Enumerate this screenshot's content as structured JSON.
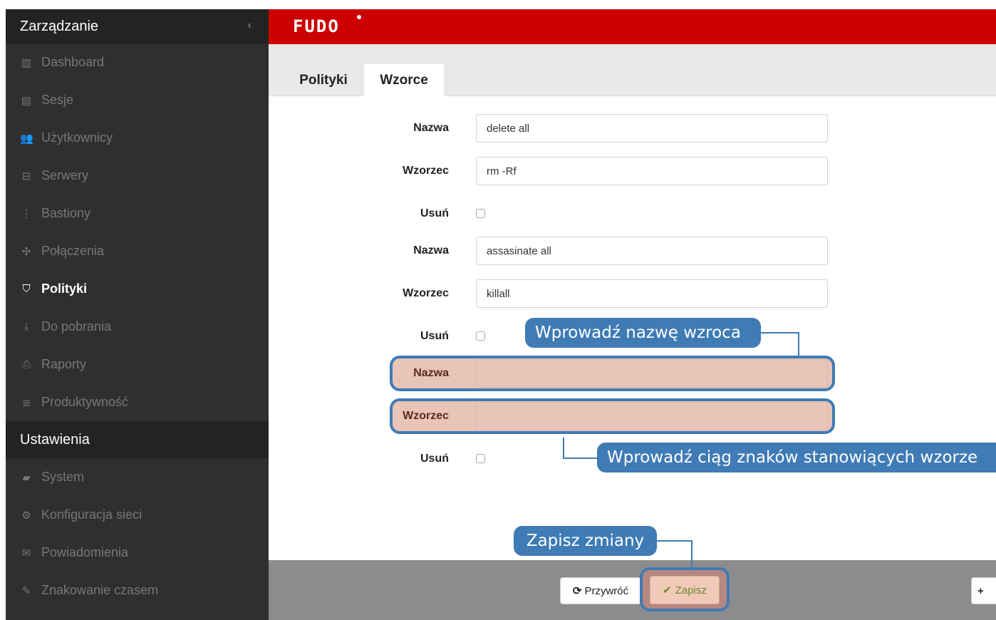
{
  "sidebar": {
    "section_management": "Zarządzanie",
    "collapse_glyph": "‹",
    "items": [
      {
        "icon": "▥",
        "label": "Dashboard"
      },
      {
        "icon": "▤",
        "label": "Sesje"
      },
      {
        "icon": "👥",
        "label": "Użytkownicy"
      },
      {
        "icon": "⊟",
        "label": "Serwery"
      },
      {
        "icon": "⋮",
        "label": "Bastiony"
      },
      {
        "icon": "✣",
        "label": "Połączenia"
      },
      {
        "icon": "⛉",
        "label": "Polityki"
      },
      {
        "icon": "⤓",
        "label": "Do pobrania"
      },
      {
        "icon": "⎙",
        "label": "Raporty"
      },
      {
        "icon": "≣",
        "label": "Produktywność"
      }
    ],
    "section_settings": "Ustawienia",
    "settings_items": [
      {
        "icon": "▰",
        "label": "System"
      },
      {
        "icon": "⚙",
        "label": "Konfiguracja sieci"
      },
      {
        "icon": "✉",
        "label": "Powiadomienia"
      },
      {
        "icon": "✎",
        "label": "Znakowanie czasem"
      }
    ],
    "active_item": "Polityki"
  },
  "header": {
    "logo_text": "FUDO"
  },
  "tabs": [
    {
      "label": "Polityki",
      "active": false
    },
    {
      "label": "Wzorce",
      "active": true
    }
  ],
  "form": {
    "name_label": "Nazwa",
    "pattern_label": "Wzorzec",
    "delete_label": "Usuń",
    "entries": [
      {
        "name": "delete all",
        "pattern": "rm -Rf",
        "delete": false
      },
      {
        "name": "assasinate all",
        "pattern": "killall",
        "delete": false
      },
      {
        "name": "",
        "pattern": "",
        "delete": false
      }
    ]
  },
  "callouts": {
    "enter_name": "Wprowadź nazwę wzroca",
    "enter_pattern": "Wprowadź ciąg znaków stanowiących wzorze",
    "save_changes": "Zapisz zmiany"
  },
  "buttons": {
    "restore_icon": "⟳",
    "restore_label": "Przywróć",
    "save_icon": "✔",
    "save_label": "Zapisz",
    "add_icon": "+"
  },
  "colors": {
    "brand_red": "#cc0000",
    "sidebar_bg": "#2f2f2f",
    "callout_blue": "#3f7bb5",
    "highlight_fill": "#e8c4b9"
  }
}
